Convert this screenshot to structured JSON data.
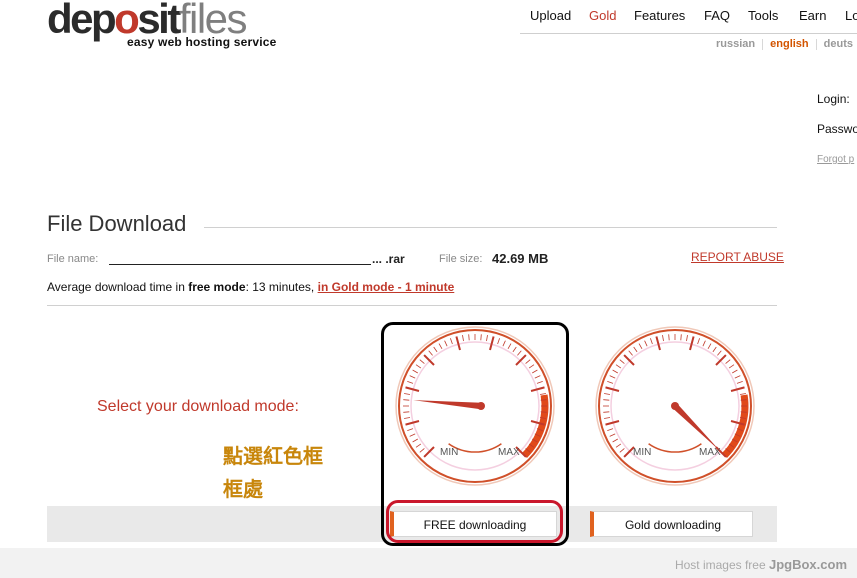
{
  "logo": {
    "part1": "dep",
    "part_o": "o",
    "part2": "sit",
    "part3": "files",
    "tagline": "easy web hosting service"
  },
  "nav": {
    "items": [
      "Upload",
      "Gold",
      "Features",
      "FAQ",
      "Tools",
      "Earn",
      "Lo"
    ],
    "active": "Gold"
  },
  "languages": {
    "items": [
      "russian",
      "english",
      "deuts"
    ],
    "active": "english"
  },
  "login": {
    "login_label": "Login:",
    "password_label": "Passwo",
    "forgot_label": "Forgot p"
  },
  "download": {
    "title": "File Download",
    "file_name_label": "File name:",
    "file_name_ext": "... .rar",
    "file_size_label": "File size:",
    "file_size": "42.69 MB",
    "report_abuse": "REPORT ABUSE",
    "avg_prefix": "Average download time in ",
    "avg_free_mode": "free mode",
    "avg_middle": ": 13 minutes, ",
    "avg_gold_link": "in Gold mode - 1 minute",
    "select_mode": "Select your download mode:",
    "annotation_line1": "點選紅色框",
    "annotation_line2": "框處"
  },
  "gauges": [
    {
      "min_label": "MIN",
      "max_label": "MAX",
      "needle_level": 0.02
    },
    {
      "min_label": "MIN",
      "max_label": "MAX",
      "needle_level": 0.86
    }
  ],
  "buttons": {
    "free": "FREE downloading",
    "gold": "Gold downloading"
  },
  "footer": {
    "text": "Host images free ",
    "brand": "JpgBox.com"
  },
  "colors": {
    "accent": "#c0392b",
    "orange": "#e0621f",
    "annotation_red": "#c9162b"
  }
}
